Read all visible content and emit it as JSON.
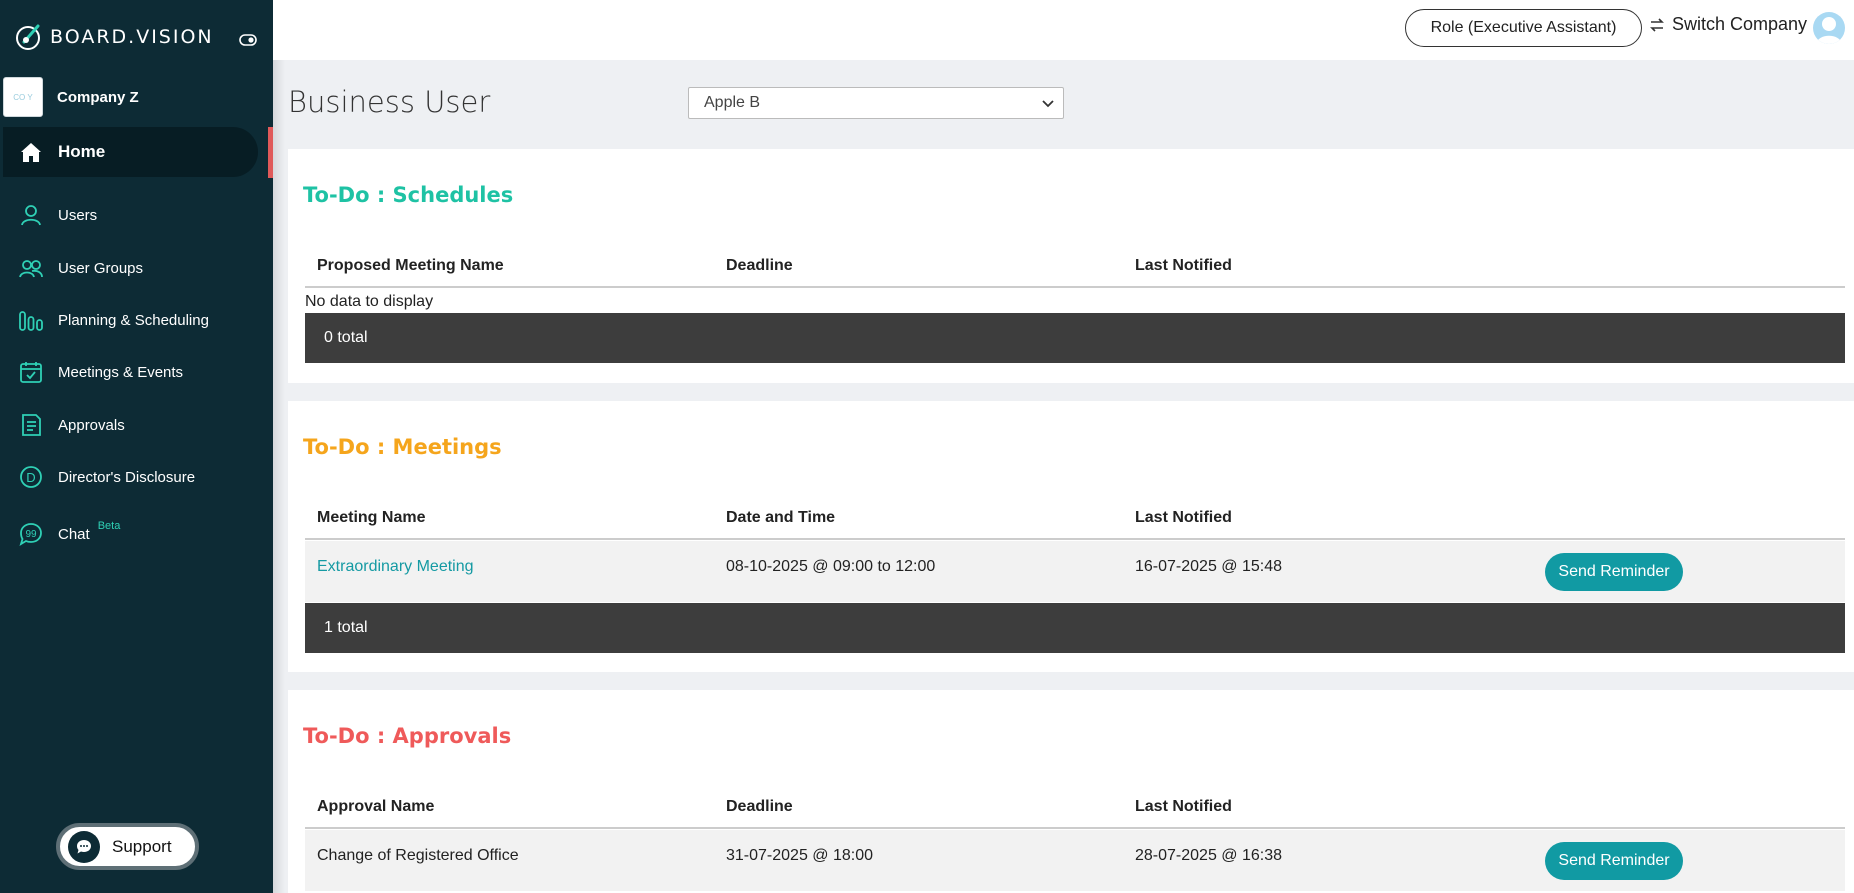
{
  "brand": {
    "name": "BOARD.VISION"
  },
  "company": {
    "name": "Company Z",
    "logo_text": "CO Y"
  },
  "nav": [
    {
      "label": "Home",
      "icon": "home-icon",
      "active": true
    },
    {
      "label": "Users",
      "icon": "user-icon"
    },
    {
      "label": "User Groups",
      "icon": "users-icon"
    },
    {
      "label": "Planning & Scheduling",
      "icon": "bar-chart-icon"
    },
    {
      "label": "Meetings & Events",
      "icon": "calendar-check-icon"
    },
    {
      "label": "Approvals",
      "icon": "document-icon"
    },
    {
      "label": "Director's Disclosure",
      "icon": "circle-d-icon"
    },
    {
      "label": "Chat",
      "icon": "chat-icon",
      "badge": "Beta"
    }
  ],
  "support": {
    "label": "Support"
  },
  "topbar": {
    "role_label": "Role (Executive Assistant)",
    "switch_label": "Switch Company"
  },
  "header": {
    "title": "Business User",
    "selected_company": "Apple B"
  },
  "colors": {
    "sidebar": "#0d2b35",
    "accent": "#119aa3",
    "schedules": "#1ec2a4",
    "meetings": "#f5a51c",
    "approvals": "#ef5a5a"
  },
  "schedules": {
    "title": "To-Do : Schedules",
    "columns": [
      "Proposed Meeting Name",
      "Deadline",
      "Last Notified"
    ],
    "empty_text": "No data to display",
    "total": "0 total"
  },
  "meetings": {
    "title": "To-Do : Meetings",
    "columns": [
      "Meeting Name",
      "Date and Time",
      "Last Notified"
    ],
    "rows": [
      {
        "name": "Extraordinary Meeting",
        "date": "08-10-2025 @ 09:00 to 12:00",
        "notified": "16-07-2025 @ 15:48",
        "action": "Send Reminder"
      }
    ],
    "total": "1 total"
  },
  "approvals": {
    "title": "To-Do : Approvals",
    "columns": [
      "Approval Name",
      "Deadline",
      "Last Notified"
    ],
    "rows": [
      {
        "name": "Change of Registered Office",
        "deadline": "31-07-2025 @ 18:00",
        "notified": "28-07-2025 @ 16:38",
        "action": "Send Reminder"
      }
    ]
  }
}
